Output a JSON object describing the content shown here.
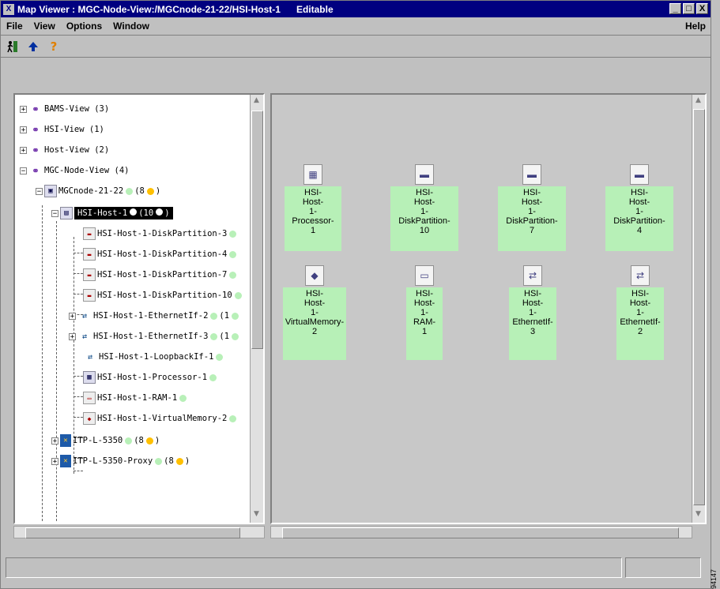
{
  "window": {
    "title": "Map Viewer : MGC-Node-View:/MGCnode-21-22/HSI-Host-1",
    "mode": "Editable",
    "app_icon": "X",
    "buttons": {
      "minimize": "_",
      "maximize": "□",
      "close": "X"
    }
  },
  "menu": {
    "file": "File",
    "view": "View",
    "options": "Options",
    "window": "Window",
    "help": "Help"
  },
  "toolbar": {
    "exit_icon": "exit-icon",
    "up_icon": "up-arrow-icon",
    "help_icon": "question-mark-icon",
    "help_symbol": "?"
  },
  "tree": {
    "bams": "BAMS-View (3)",
    "hsi_view": "HSI-View (1)",
    "host_view": "Host-View (2)",
    "mgc_view": "MGC-Node-View (4)",
    "mgc_node": "MGCnode-21-22",
    "mgc_node_count_open": "(8",
    "mgc_node_count_close": ")",
    "host": "HSI-Host-1",
    "host_count_open": "(10",
    "host_count_close": ")",
    "children": [
      "HSI-Host-1-DiskPartition-3",
      "HSI-Host-1-DiskPartition-4",
      "HSI-Host-1-DiskPartition-7",
      "HSI-Host-1-DiskPartition-10",
      "HSI-Host-1-EthernetIf-2",
      "HSI-Host-1-EthernetIf-3",
      "HSI-Host-1-LoopbackIf-1",
      "HSI-Host-1-Processor-1",
      "HSI-Host-1-RAM-1",
      "HSI-Host-1-VirtualMemory-2"
    ],
    "eth_count": "(1",
    "itp1": "ITP-L-5350",
    "itp1_count_open": "(8",
    "itp1_count_close": ")",
    "itp2": "ITP-L-5350-Proxy",
    "itp2_count_open": "(8",
    "itp2_count_close": ")"
  },
  "map_nodes": [
    {
      "lines": [
        "HSI-",
        "Host-",
        "1-",
        "Processor-",
        "1"
      ]
    },
    {
      "lines": [
        "HSI-",
        "Host-",
        "1-",
        "DiskPartition-",
        "10"
      ]
    },
    {
      "lines": [
        "HSI-",
        "Host-",
        "1-",
        "DiskPartition-",
        "7"
      ]
    },
    {
      "lines": [
        "HSI-",
        "Host-",
        "1-",
        "DiskPartition-",
        "4"
      ]
    },
    {
      "lines": [
        "HSI-",
        "Host-",
        "1-",
        "VirtualMemory-",
        "2"
      ]
    },
    {
      "lines": [
        "HSI-",
        "Host-",
        "1-",
        "RAM-",
        "1"
      ]
    },
    {
      "lines": [
        "HSI-",
        "Host-",
        "1-",
        "EthernetIf-",
        "3"
      ]
    },
    {
      "lines": [
        "HSI-",
        "Host-",
        "1-",
        "EthernetIf-",
        "2"
      ]
    }
  ],
  "side_label": "94147",
  "colors": {
    "titlebar": "#000080",
    "node_label": "#b7f0b7",
    "status_green": "#b8f0b8",
    "status_orange": "#ffc000"
  }
}
